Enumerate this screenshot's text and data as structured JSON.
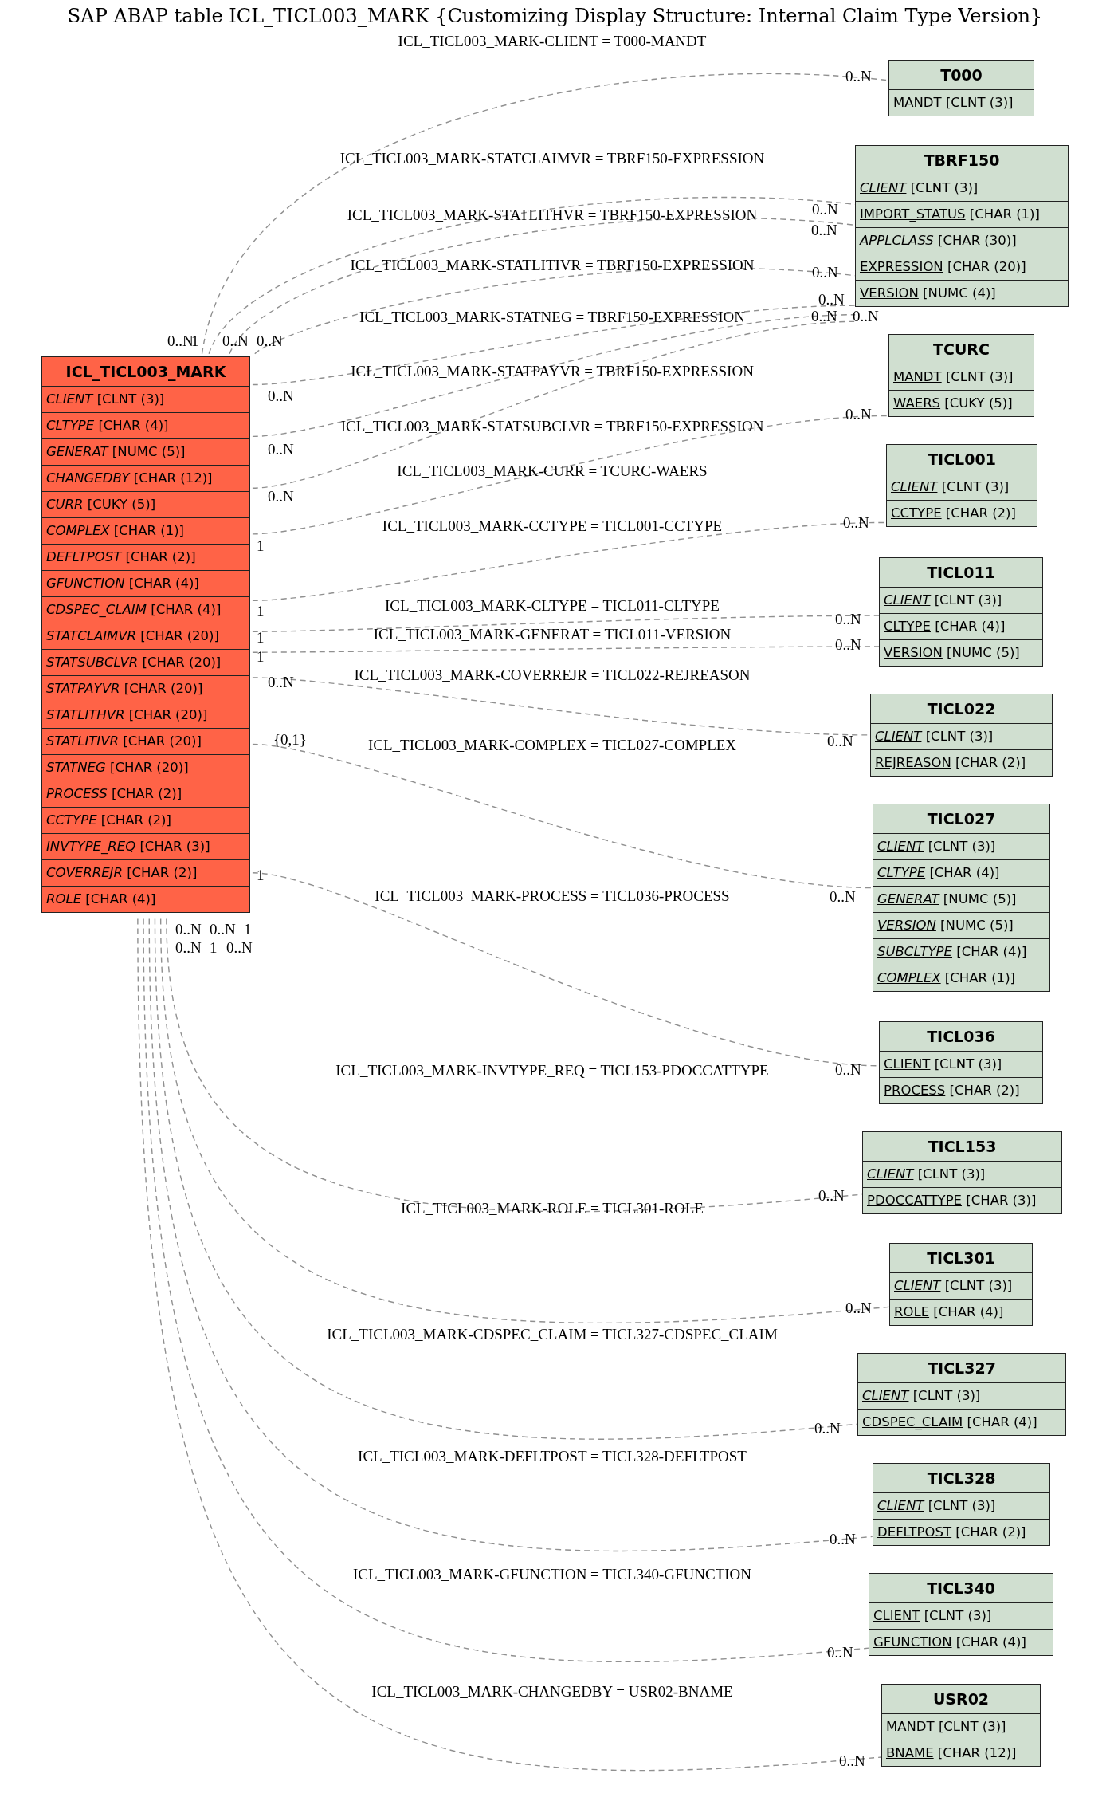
{
  "title": "SAP ABAP table ICL_TICL003_MARK {Customizing Display Structure: Internal Claim Type Version}",
  "tables": [
    {
      "name": "ICL_TICL003_MARK",
      "kind": "main",
      "fields": [
        {
          "name": "CLIENT",
          "type": "[CLNT (3)]",
          "key": false,
          "italic": true
        },
        {
          "name": "CLTYPE",
          "type": "[CHAR (4)]",
          "key": false,
          "italic": true
        },
        {
          "name": "GENERAT",
          "type": "[NUMC (5)]",
          "key": false,
          "italic": true
        },
        {
          "name": "CHANGEDBY",
          "type": "[CHAR (12)]",
          "key": false,
          "italic": true
        },
        {
          "name": "CURR",
          "type": "[CUKY (5)]",
          "key": false,
          "italic": true
        },
        {
          "name": "COMPLEX",
          "type": "[CHAR (1)]",
          "key": false,
          "italic": true
        },
        {
          "name": "DEFLTPOST",
          "type": "[CHAR (2)]",
          "key": false,
          "italic": true
        },
        {
          "name": "GFUNCTION",
          "type": "[CHAR (4)]",
          "key": false,
          "italic": true
        },
        {
          "name": "CDSPEC_CLAIM",
          "type": "[CHAR (4)]",
          "key": false,
          "italic": true
        },
        {
          "name": "STATCLAIMVR",
          "type": "[CHAR (20)]",
          "key": false,
          "italic": true
        },
        {
          "name": "STATSUBCLVR",
          "type": "[CHAR (20)]",
          "key": false,
          "italic": true
        },
        {
          "name": "STATPAYVR",
          "type": "[CHAR (20)]",
          "key": false,
          "italic": true
        },
        {
          "name": "STATLITHVR",
          "type": "[CHAR (20)]",
          "key": false,
          "italic": true
        },
        {
          "name": "STATLITIVR",
          "type": "[CHAR (20)]",
          "key": false,
          "italic": true
        },
        {
          "name": "STATNEG",
          "type": "[CHAR (20)]",
          "key": false,
          "italic": true
        },
        {
          "name": "PROCESS",
          "type": "[CHAR (2)]",
          "key": false,
          "italic": true
        },
        {
          "name": "CCTYPE",
          "type": "[CHAR (2)]",
          "key": false,
          "italic": true
        },
        {
          "name": "INVTYPE_REQ",
          "type": "[CHAR (3)]",
          "key": false,
          "italic": true
        },
        {
          "name": "COVERREJR",
          "type": "[CHAR (2)]",
          "key": false,
          "italic": true
        },
        {
          "name": "ROLE",
          "type": "[CHAR (4)]",
          "key": false,
          "italic": true
        }
      ]
    },
    {
      "name": "T000",
      "kind": "related",
      "fields": [
        {
          "name": "MANDT",
          "type": "[CLNT (3)]",
          "key": true,
          "italic": false
        }
      ]
    },
    {
      "name": "TBRF150",
      "kind": "related",
      "fields": [
        {
          "name": "CLIENT",
          "type": "[CLNT (3)]",
          "key": true,
          "italic": true
        },
        {
          "name": "IMPORT_STATUS",
          "type": "[CHAR (1)]",
          "key": true,
          "italic": false
        },
        {
          "name": "APPLCLASS",
          "type": "[CHAR (30)]",
          "key": true,
          "italic": true
        },
        {
          "name": "EXPRESSION",
          "type": "[CHAR (20)]",
          "key": true,
          "italic": false
        },
        {
          "name": "VERSION",
          "type": "[NUMC (4)]",
          "key": true,
          "italic": false
        }
      ]
    },
    {
      "name": "TCURC",
      "kind": "related",
      "fields": [
        {
          "name": "MANDT",
          "type": "[CLNT (3)]",
          "key": true,
          "italic": false
        },
        {
          "name": "WAERS",
          "type": "[CUKY (5)]",
          "key": true,
          "italic": false
        }
      ]
    },
    {
      "name": "TICL001",
      "kind": "related",
      "fields": [
        {
          "name": "CLIENT",
          "type": "[CLNT (3)]",
          "key": true,
          "italic": true
        },
        {
          "name": "CCTYPE",
          "type": "[CHAR (2)]",
          "key": true,
          "italic": false
        }
      ]
    },
    {
      "name": "TICL011",
      "kind": "related",
      "fields": [
        {
          "name": "CLIENT",
          "type": "[CLNT (3)]",
          "key": true,
          "italic": true
        },
        {
          "name": "CLTYPE",
          "type": "[CHAR (4)]",
          "key": true,
          "italic": false
        },
        {
          "name": "VERSION",
          "type": "[NUMC (5)]",
          "key": true,
          "italic": false
        }
      ]
    },
    {
      "name": "TICL022",
      "kind": "related",
      "fields": [
        {
          "name": "CLIENT",
          "type": "[CLNT (3)]",
          "key": true,
          "italic": true
        },
        {
          "name": "REJREASON",
          "type": "[CHAR (2)]",
          "key": true,
          "italic": false
        }
      ]
    },
    {
      "name": "TICL027",
      "kind": "related",
      "fields": [
        {
          "name": "CLIENT",
          "type": "[CLNT (3)]",
          "key": true,
          "italic": true
        },
        {
          "name": "CLTYPE",
          "type": "[CHAR (4)]",
          "key": true,
          "italic": true
        },
        {
          "name": "GENERAT",
          "type": "[NUMC (5)]",
          "key": true,
          "italic": true
        },
        {
          "name": "VERSION",
          "type": "[NUMC (5)]",
          "key": true,
          "italic": true
        },
        {
          "name": "SUBCLTYPE",
          "type": "[CHAR (4)]",
          "key": true,
          "italic": true
        },
        {
          "name": "COMPLEX",
          "type": "[CHAR (1)]",
          "key": true,
          "italic": true
        }
      ]
    },
    {
      "name": "TICL036",
      "kind": "related",
      "fields": [
        {
          "name": "CLIENT",
          "type": "[CLNT (3)]",
          "key": true,
          "italic": false
        },
        {
          "name": "PROCESS",
          "type": "[CHAR (2)]",
          "key": true,
          "italic": false
        }
      ]
    },
    {
      "name": "TICL153",
      "kind": "related",
      "fields": [
        {
          "name": "CLIENT",
          "type": "[CLNT (3)]",
          "key": true,
          "italic": true
        },
        {
          "name": "PDOCCATTYPE",
          "type": "[CHAR (3)]",
          "key": true,
          "italic": false
        }
      ]
    },
    {
      "name": "TICL301",
      "kind": "related",
      "fields": [
        {
          "name": "CLIENT",
          "type": "[CLNT (3)]",
          "key": true,
          "italic": true
        },
        {
          "name": "ROLE",
          "type": "[CHAR (4)]",
          "key": true,
          "italic": false
        }
      ]
    },
    {
      "name": "TICL327",
      "kind": "related",
      "fields": [
        {
          "name": "CLIENT",
          "type": "[CLNT (3)]",
          "key": true,
          "italic": true
        },
        {
          "name": "CDSPEC_CLAIM",
          "type": "[CHAR (4)]",
          "key": true,
          "italic": false
        }
      ]
    },
    {
      "name": "TICL328",
      "kind": "related",
      "fields": [
        {
          "name": "CLIENT",
          "type": "[CLNT (3)]",
          "key": true,
          "italic": true
        },
        {
          "name": "DEFLTPOST",
          "type": "[CHAR (2)]",
          "key": true,
          "italic": false
        }
      ]
    },
    {
      "name": "TICL340",
      "kind": "related",
      "fields": [
        {
          "name": "CLIENT",
          "type": "[CLNT (3)]",
          "key": true,
          "italic": false
        },
        {
          "name": "GFUNCTION",
          "type": "[CHAR (4)]",
          "key": true,
          "italic": false
        }
      ]
    },
    {
      "name": "USR02",
      "kind": "related",
      "fields": [
        {
          "name": "MANDT",
          "type": "[CLNT (3)]",
          "key": true,
          "italic": false
        },
        {
          "name": "BNAME",
          "type": "[CHAR (12)]",
          "key": true,
          "italic": false
        }
      ]
    }
  ],
  "relations": [
    {
      "label": "ICL_TICL003_MARK-CLIENT = T000-MANDT",
      "source_cardinality": "0..N",
      "target_cardinality": "0..N"
    },
    {
      "label": "ICL_TICL003_MARK-STATCLAIMVR = TBRF150-EXPRESSION",
      "source_cardinality": "1",
      "target_cardinality": "0..N"
    },
    {
      "label": "ICL_TICL003_MARK-STATLITHVR = TBRF150-EXPRESSION",
      "source_cardinality": "0..N",
      "target_cardinality": "0..N"
    },
    {
      "label": "ICL_TICL003_MARK-STATLITIVR = TBRF150-EXPRESSION",
      "source_cardinality": "0..N",
      "target_cardinality": "0..N"
    },
    {
      "label": "ICL_TICL003_MARK-STATNEG = TBRF150-EXPRESSION",
      "source_cardinality": "0..N",
      "target_cardinality": "0..N"
    },
    {
      "label": "ICL_TICL003_MARK-STATPAYVR = TBRF150-EXPRESSION",
      "source_cardinality": "0..N",
      "target_cardinality": "0..N"
    },
    {
      "label": "ICL_TICL003_MARK-STATSUBCLVR = TBRF150-EXPRESSION",
      "source_cardinality": "0..N",
      "target_cardinality": "0..N"
    },
    {
      "label": "ICL_TICL003_MARK-CURR = TCURC-WAERS",
      "source_cardinality": "1",
      "target_cardinality": "0..N"
    },
    {
      "label": "ICL_TICL003_MARK-CCTYPE = TICL001-CCTYPE",
      "source_cardinality": "1",
      "target_cardinality": "0..N"
    },
    {
      "label": "ICL_TICL003_MARK-CLTYPE = TICL011-CLTYPE",
      "source_cardinality": "1",
      "target_cardinality": "0..N"
    },
    {
      "label": "ICL_TICL003_MARK-GENERAT = TICL011-VERSION",
      "source_cardinality": "1",
      "target_cardinality": "0..N"
    },
    {
      "label": "ICL_TICL003_MARK-COVERREJR = TICL022-REJREASON",
      "source_cardinality": "0..N",
      "target_cardinality": "0..N"
    },
    {
      "label": "ICL_TICL003_MARK-COMPLEX = TICL027-COMPLEX",
      "source_cardinality": "{0,1}",
      "target_cardinality": "0..N"
    },
    {
      "label": "ICL_TICL003_MARK-PROCESS = TICL036-PROCESS",
      "source_cardinality": "1",
      "target_cardinality": "0..N"
    },
    {
      "label": "ICL_TICL003_MARK-INVTYPE_REQ = TICL153-PDOCCATTYPE",
      "source_cardinality": "0..N",
      "target_cardinality": "0..N"
    },
    {
      "label": "ICL_TICL003_MARK-ROLE = TICL301-ROLE",
      "source_cardinality": "0..N",
      "target_cardinality": "0..N"
    },
    {
      "label": "ICL_TICL003_MARK-CDSPEC_CLAIM = TICL327-CDSPEC_CLAIM",
      "source_cardinality": "1",
      "target_cardinality": "0..N"
    },
    {
      "label": "ICL_TICL003_MARK-DEFLTPOST = TICL328-DEFLTPOST",
      "source_cardinality": "0..N",
      "target_cardinality": "0..N"
    },
    {
      "label": "ICL_TICL003_MARK-GFUNCTION = TICL340-GFUNCTION",
      "source_cardinality": "1",
      "target_cardinality": "0..N"
    },
    {
      "label": "ICL_TICL003_MARK-CHANGEDBY = USR02-BNAME",
      "source_cardinality": "0..N",
      "target_cardinality": "0..N"
    }
  ]
}
